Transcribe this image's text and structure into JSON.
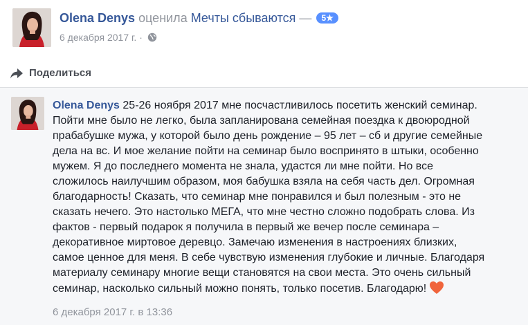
{
  "post": {
    "author": "Olena Denys",
    "action": "оценила",
    "page": "Мечты сбываются",
    "dash": "—",
    "rating": "5★",
    "date": "6 декабря 2017 г.",
    "separator": "·",
    "privacy_icon": "globe-icon"
  },
  "share": {
    "label": "Поделиться",
    "icon": "share-arrow-icon"
  },
  "comment": {
    "author": "Olena Denys",
    "lines": [
      "25-26 ноября 2017 мне посчастливилось посетить женский семинар.",
      "Пойти мне было не легко, была запланирована семейная поездка к двоюродной",
      "прабабушке мужа, у которой было день рождение – 95 лет – сб и другие семейные",
      "дела на вс. И мое желание пойти на семинар было воспринято в штыки, особенно",
      "мужем. Я до последнего момента не знала, удастся ли мне пойти. Но все",
      "сложилось наилучшим образом, моя бабушка взяла на себя часть дел. Огромная",
      "благодарность! Сказать, что семинар мне понравился и был полезным - это не",
      "сказать нечего. Это настолько МЕГА, что мне честно сложно подобрать слова. Из",
      "фактов - первый подарок я получила в первый же вечер после семинара –",
      "декоративное миртовое деревцо. Замечаю изменения в настроениях близких,",
      "самое ценное для меня. В себе чувствую изменения глубокие и личные. Благодаря",
      "материалу семинару многие вещи становятся на свои места. Это очень сильный",
      "семинар, насколько сильный можно понять, только посетив. Благодарю!"
    ],
    "emoji": "heart-icon",
    "timestamp": "6 декабря 2017 г. в 13:36"
  },
  "colors": {
    "link": "#365899",
    "meta": "#90949c",
    "badge": "#5890ff",
    "heart": "#f0643c"
  }
}
